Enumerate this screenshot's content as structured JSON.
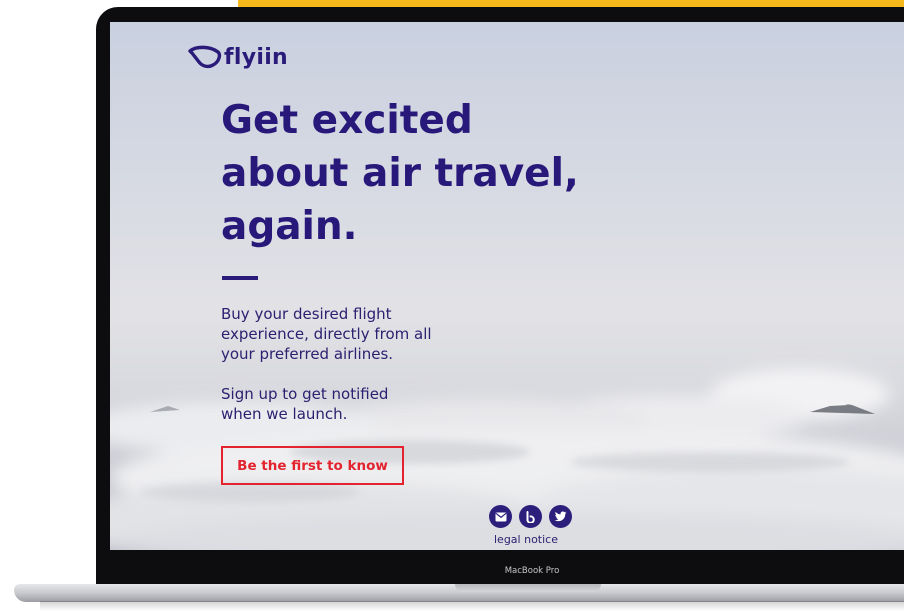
{
  "colors": {
    "accent_bar": "#f6b91c",
    "brand_navy": "#2a1b7a",
    "cta_red": "#e3242f"
  },
  "brand": {
    "logo_text": "flyiin",
    "logo_icon": "flyiin-logo-icon"
  },
  "hero": {
    "headline": [
      "Get excited",
      "about air travel,",
      "again."
    ],
    "description": [
      "Buy your desired flight",
      "experience, directly from all",
      "your preferred airlines."
    ],
    "signup_text": [
      "Sign up to get notified",
      "when we launch."
    ],
    "cta_label": "Be the first to know"
  },
  "footer": {
    "social_icons": [
      "mail-icon",
      "blog-icon",
      "twitter-icon"
    ],
    "legal_link": "legal notice"
  },
  "device": {
    "label": "MacBook Pro"
  }
}
